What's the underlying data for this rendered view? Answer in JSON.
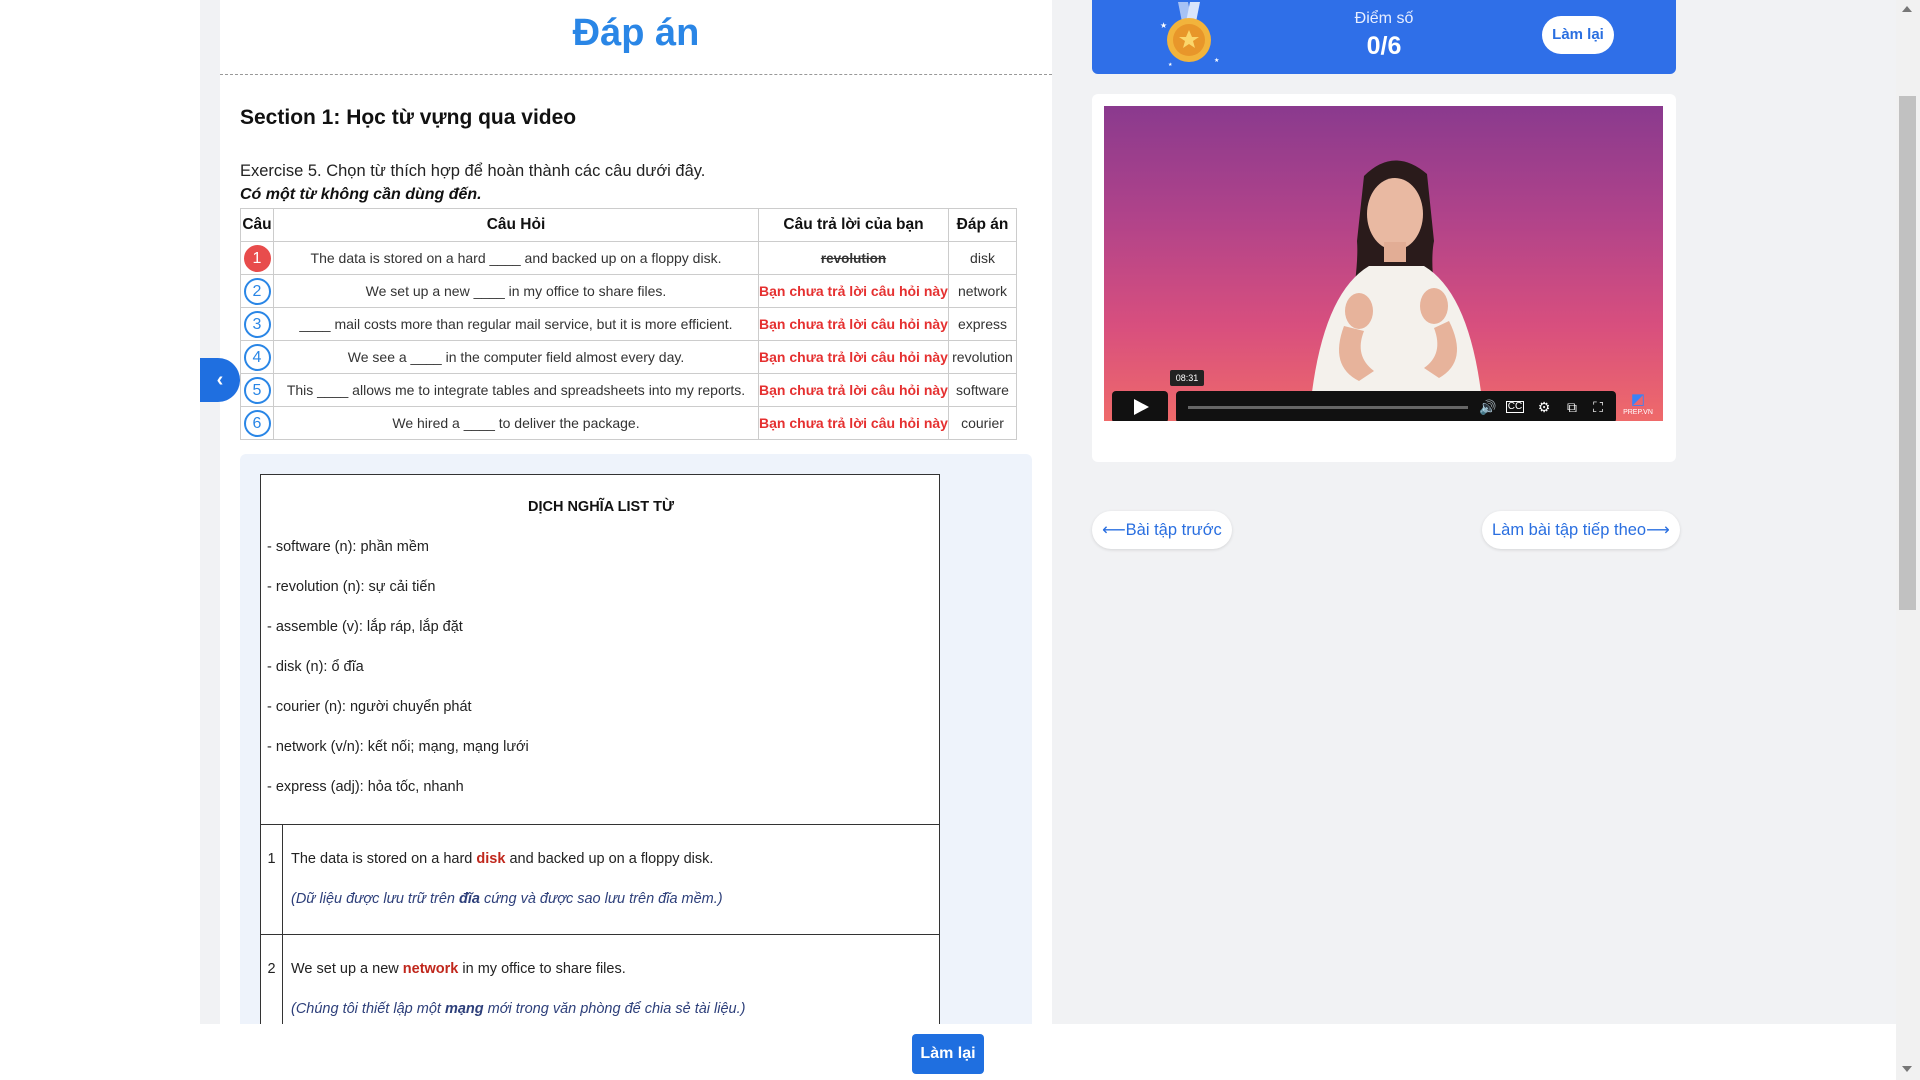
{
  "header": {
    "title": "Đáp án"
  },
  "section": {
    "title": "Section 1: Học từ vựng qua video"
  },
  "exercise": {
    "instruction": "Exercise 5. Chọn từ thích hợp để hoàn thành các câu dưới đây.",
    "note": "Có một từ không cần dùng đến."
  },
  "table": {
    "headers": [
      "Câu",
      "Câu Hỏi",
      "Câu trả lời của bạn",
      "Đáp án"
    ],
    "rows": [
      {
        "num": "1",
        "question": "The data is stored on a hard ____ and backed up on a floppy disk.",
        "answer": "revolution",
        "key": "disk"
      },
      {
        "num": "2",
        "question": "We set up a new ____ in my office to share files.",
        "answer": "Bạn chưa trả lời câu hỏi này",
        "key": "network"
      },
      {
        "num": "3",
        "question": "____ mail costs more than regular mail service, but it is more efficient.",
        "answer": "Bạn chưa trả lời câu hỏi này",
        "key": "express"
      },
      {
        "num": "4",
        "question": "We see a ____ in the computer field almost every day.",
        "answer": "Bạn chưa trả lời câu hỏi này",
        "key": "revolution"
      },
      {
        "num": "5",
        "question": "This ____ allows me to integrate tables and spreadsheets into my reports.",
        "answer": "Bạn chưa trả lời câu hỏi này",
        "key": "software"
      },
      {
        "num": "6",
        "question": "We hired a ____ to deliver the package.",
        "answer": "Bạn chưa trả lời câu hỏi này",
        "key": "courier"
      }
    ]
  },
  "translation": {
    "title": "DỊCH NGHĨA LIST TỪ",
    "vocab": [
      "- software (n): phần mềm",
      "- revolution (n): sự cải tiến",
      "- assemble (v): lắp ráp, lắp đặt",
      "- disk (n): ổ đĩa",
      "- courier (n): người chuyển phát",
      "- network (v/n): kết nối; mạng, mạng lưới",
      "- express (adj): hỏa tốc, nhanh"
    ],
    "rows": [
      {
        "num": "1",
        "en_pre": "The data is stored on a hard ",
        "en_word": "disk",
        "en_post": " and backed up on a floppy disk.",
        "vi_pre": "(Dữ liệu được lưu trữ trên ",
        "vi_word": "đĩa",
        "vi_post": " cứng và được sao lưu trên đĩa mềm.)"
      },
      {
        "num": "2",
        "en_pre": "We set up a new ",
        "en_word": "network",
        "en_post": " in my office to share files.",
        "vi_pre": "(Chúng tôi thiết lập một ",
        "vi_word": "mạng",
        "vi_post": " mới trong văn phòng để chia sẻ tài liệu.)"
      }
    ]
  },
  "score": {
    "label": "Điểm số",
    "value": "0/6",
    "retry": "Làm lại"
  },
  "video": {
    "time_tooltip": "08:31",
    "brand": "PREP.VN"
  },
  "nav": {
    "prev": "⟵Bài tập trước",
    "next": "Làm bài tập tiếp theo⟶"
  },
  "footer": {
    "retry": "Làm lại"
  },
  "colors": {
    "accent": "#2a86e6",
    "error": "#e53030",
    "highlight": "#c0271c",
    "score_bg": "#2f6fe8"
  }
}
